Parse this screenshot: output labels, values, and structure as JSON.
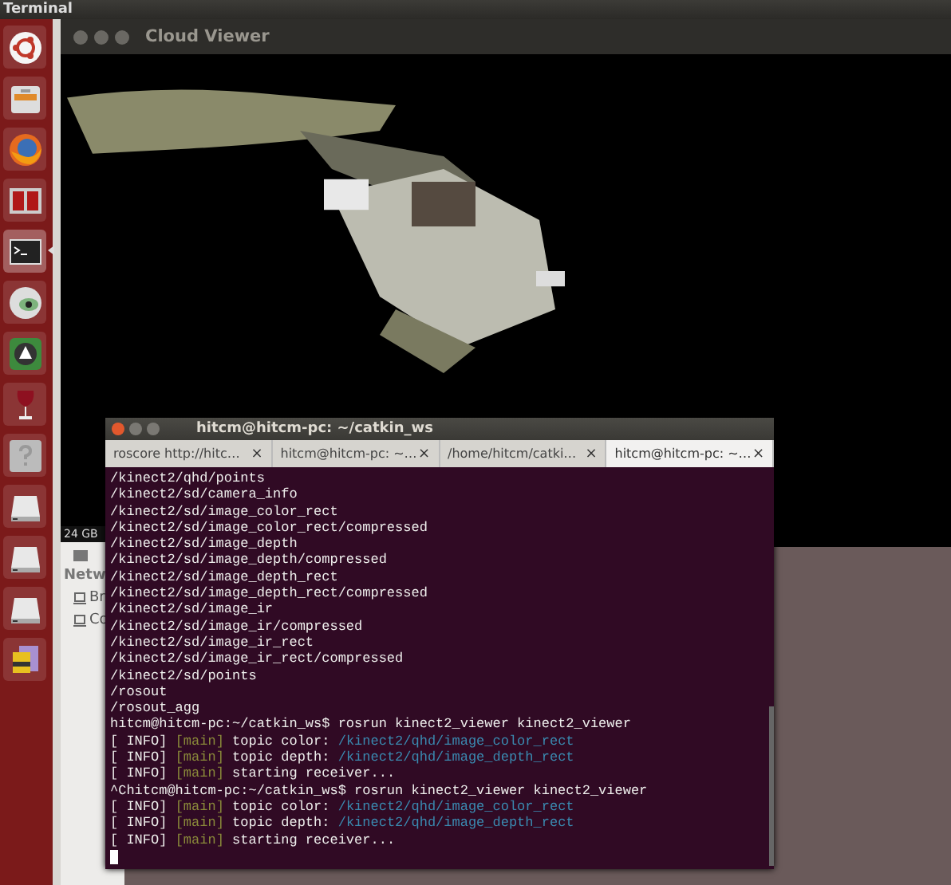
{
  "top_bar": {
    "title": "Terminal"
  },
  "launcher": {
    "items": [
      {
        "kind": "ubuntu",
        "active": false
      },
      {
        "kind": "files",
        "active": false
      },
      {
        "kind": "firefox",
        "active": false
      },
      {
        "kind": "monitor",
        "active": false
      },
      {
        "kind": "terminal",
        "active": true
      },
      {
        "kind": "eye",
        "active": false
      },
      {
        "kind": "updater",
        "active": false
      },
      {
        "kind": "wine",
        "active": false
      },
      {
        "kind": "help",
        "active": false
      },
      {
        "kind": "drive",
        "active": false
      },
      {
        "kind": "drive",
        "active": false
      },
      {
        "kind": "drive",
        "active": false
      },
      {
        "kind": "notes",
        "active": false
      }
    ]
  },
  "cloud_viewer": {
    "title": "Cloud Viewer"
  },
  "file_manager": {
    "size": "24 GB",
    "section": "Netw",
    "items": [
      "Br",
      "Co"
    ]
  },
  "terminal": {
    "title": "hitcm@hitcm-pc: ~/catkin_ws",
    "tabs": [
      {
        "label": "roscore http://hitc…",
        "close": "×",
        "selected": false
      },
      {
        "label": "hitcm@hitcm-pc: ~…",
        "close": "×",
        "selected": false
      },
      {
        "label": "/home/hitcm/catki…",
        "close": "×",
        "selected": false
      },
      {
        "label": "hitcm@hitcm-pc: ~…",
        "close": "×",
        "selected": true
      }
    ],
    "lines": [
      {
        "kind": "plain",
        "text": "/kinect2/qhd/points"
      },
      {
        "kind": "plain",
        "text": "/kinect2/sd/camera_info"
      },
      {
        "kind": "plain",
        "text": "/kinect2/sd/image_color_rect"
      },
      {
        "kind": "plain",
        "text": "/kinect2/sd/image_color_rect/compressed"
      },
      {
        "kind": "plain",
        "text": "/kinect2/sd/image_depth"
      },
      {
        "kind": "plain",
        "text": "/kinect2/sd/image_depth/compressed"
      },
      {
        "kind": "plain",
        "text": "/kinect2/sd/image_depth_rect"
      },
      {
        "kind": "plain",
        "text": "/kinect2/sd/image_depth_rect/compressed"
      },
      {
        "kind": "plain",
        "text": "/kinect2/sd/image_ir"
      },
      {
        "kind": "plain",
        "text": "/kinect2/sd/image_ir/compressed"
      },
      {
        "kind": "plain",
        "text": "/kinect2/sd/image_ir_rect"
      },
      {
        "kind": "plain",
        "text": "/kinect2/sd/image_ir_rect/compressed"
      },
      {
        "kind": "plain",
        "text": "/kinect2/sd/points"
      },
      {
        "kind": "plain",
        "text": "/rosout"
      },
      {
        "kind": "plain",
        "text": "/rosout_agg"
      },
      {
        "kind": "plain",
        "text": "hitcm@hitcm-pc:~/catkin_ws$ rosrun kinect2_viewer kinect2_viewer"
      },
      {
        "kind": "info",
        "tag": "[ INFO]",
        "source": "[main]",
        "message": "topic color:",
        "path": "/kinect2/qhd/image_color_rect"
      },
      {
        "kind": "info",
        "tag": "[ INFO]",
        "source": "[main]",
        "message": "topic depth:",
        "path": "/kinect2/qhd/image_depth_rect"
      },
      {
        "kind": "info",
        "tag": "[ INFO]",
        "source": "[main]",
        "message": "starting receiver..."
      },
      {
        "kind": "plain",
        "text": "^Chitcm@hitcm-pc:~/catkin_ws$ rosrun kinect2_viewer kinect2_viewer"
      },
      {
        "kind": "info",
        "tag": "[ INFO]",
        "source": "[main]",
        "message": "topic color:",
        "path": "/kinect2/qhd/image_color_rect"
      },
      {
        "kind": "info",
        "tag": "[ INFO]",
        "source": "[main]",
        "message": "topic depth:",
        "path": "/kinect2/qhd/image_depth_rect"
      },
      {
        "kind": "info",
        "tag": "[ INFO]",
        "source": "[main]",
        "message": "starting receiver..."
      }
    ]
  }
}
